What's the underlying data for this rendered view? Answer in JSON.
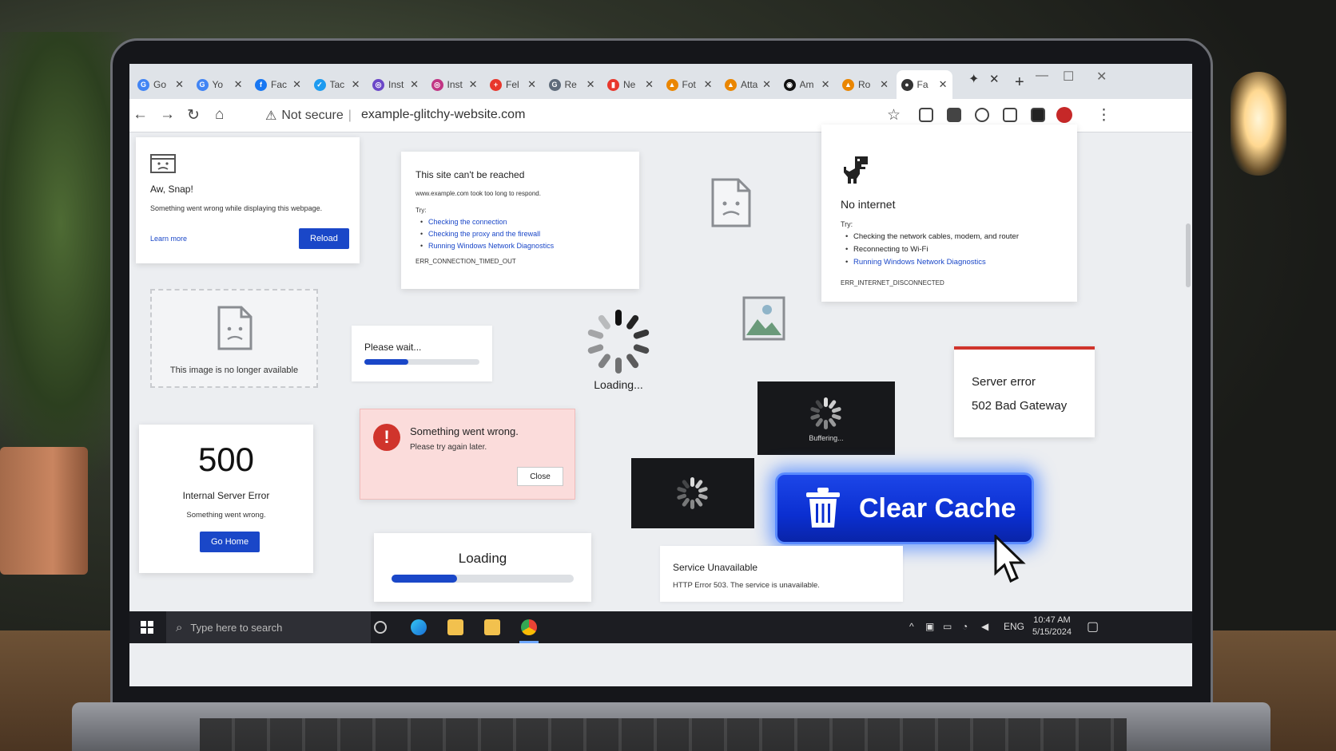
{
  "browser": {
    "tabs": [
      {
        "label": "Go",
        "color": "#4285f4",
        "glyph": "G"
      },
      {
        "label": "Yo",
        "color": "#4285f4",
        "glyph": "G"
      },
      {
        "label": "Fac",
        "color": "#1877f2",
        "glyph": "f"
      },
      {
        "label": "Tac",
        "color": "#1d9bf0",
        "glyph": "✓"
      },
      {
        "label": "Inst",
        "color": "#6b47c8",
        "glyph": "◎"
      },
      {
        "label": "Inst",
        "color": "#c13584",
        "glyph": "◎"
      },
      {
        "label": "Fel",
        "color": "#e8372c",
        "glyph": "+"
      },
      {
        "label": "Re",
        "color": "#5f6b7a",
        "glyph": "G"
      },
      {
        "label": "Ne",
        "color": "#e8372c",
        "glyph": "▮"
      },
      {
        "label": "Fot",
        "color": "#ea8600",
        "glyph": "▲"
      },
      {
        "label": "Atta",
        "color": "#ea8600",
        "glyph": "▲"
      },
      {
        "label": "Am",
        "color": "#111111",
        "glyph": "◉"
      },
      {
        "label": "Ro",
        "color": "#ea8600",
        "glyph": "▲"
      },
      {
        "label": "Fa",
        "color": "#333333",
        "glyph": "●"
      }
    ],
    "security_label": "Not secure",
    "url": "example-glitchy-website.com"
  },
  "cards": {
    "aw_snap": {
      "title": "Aw, Snap!",
      "message_pre": "Something ",
      "message_em": "went wrong while displaying this webpage.",
      "learn_more": "Learn more",
      "reload": "Reload"
    },
    "cant_reach": {
      "title": "This site can't be reached",
      "detail": "www.example.com took too long to respond.",
      "try_label": "Try:",
      "tries": [
        "Checking the connection",
        "Checking the proxy and the firewall",
        "Running Windows Network Diagnostics"
      ],
      "code": "ERR_CONNECTION_TIMED_OUT"
    },
    "no_internet": {
      "title": "No internet",
      "try_label": "Try:",
      "tries": [
        "Checking the network cables, modem, and router",
        "Reconnecting to Wi-Fi",
        "Running Windows Network Diagnostics"
      ],
      "code": "ERR_INTERNET_DISCONNECTED"
    },
    "image_unavailable": {
      "message": "This image is no longer available"
    },
    "please_wait": {
      "message": "Please wait...",
      "progress": 0.38
    },
    "loading_spinner": {
      "label": "Loading..."
    },
    "server_error": {
      "title": "Server error",
      "detail": "502 Bad Gateway",
      "accent": "#d0342c"
    },
    "error_500": {
      "code": "500",
      "title": "Internal Server Error",
      "message": "Something went wrong.",
      "button": "Go Home"
    },
    "something_wrong": {
      "title": "Something went wrong.",
      "message": "Please try again later.",
      "close": "Close"
    },
    "buffering": {
      "label": "Buffering..."
    },
    "loading_bar": {
      "label": "Loading",
      "progress": 0.36
    },
    "service_unavailable": {
      "title": "Service Unavailable",
      "message": "HTTP Error 503. The service is unavailable."
    },
    "clear_cache": {
      "label": "Clear Cache"
    }
  },
  "taskbar": {
    "search_placeholder": "Type here to search",
    "language": "ENG",
    "time": "10:47 AM",
    "date": "5/15/2024"
  },
  "colors": {
    "accent_blue": "#1a47c8",
    "error_red": "#d0342c",
    "cache_button": "#0b2fd1"
  }
}
